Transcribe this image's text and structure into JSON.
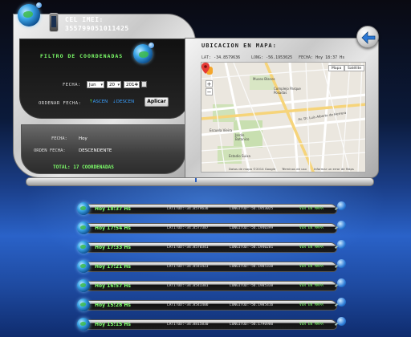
{
  "device": {
    "label": "CEL IMEI:",
    "imei": "355799051011425"
  },
  "filter": {
    "title": "FILTRO DE COORDENADAS",
    "date_label": "FECHA:",
    "month": "Jun",
    "day": "20",
    "year": "2014",
    "order_label": "ORDENAR FECHA:",
    "asc_label": "ASCEN",
    "desc_label": "DESCEN",
    "apply_label": "Aplicar"
  },
  "summary": {
    "fecha_label": "FECHA:",
    "fecha_value": "Hoy",
    "order_label": "ORDEN FECHA:",
    "order_value": "DESCENDENTE",
    "total_label": "TOTAL: 17 COORDENADAS"
  },
  "map_panel": {
    "title": "UBICACION EN MAPA:",
    "lat_label": "LAT:",
    "lat_value": "-34.8579636",
    "lng_label": "LONG:",
    "lng_value": "-56.1953025",
    "fecha_label": "FECHA:",
    "fecha_value": "Hoy 18:37 Hs",
    "map_button": "Mapa",
    "sat_button": "Satélite",
    "labels": {
      "museo": "Museo Blanes",
      "complejo": "Complejo Parque Posadas",
      "escuela": "Escuela Vieira",
      "jardin": "Jardín Botánico",
      "estadio": "Estadio Suixa",
      "avenida": "Av. Dr. Luis Alberto de Herrera"
    },
    "attribution": {
      "data": "Datos de mapa ©2014 Google",
      "terms": "Términos de uso",
      "report": "Informar un error de Maps"
    }
  },
  "colors": {
    "accent_green": "#7dff6a",
    "accent_blue": "#3aa0ff",
    "marker_red": "#e53935"
  },
  "list": {
    "lat_prefix": "LATITUD:",
    "lng_prefix": "LONGITUD:",
    "see_label": "VER EN MAPA",
    "items": [
      {
        "time": "Hoy 18:37 Hs",
        "lat": "-34.8579636",
        "lng": "-56.1953025"
      },
      {
        "time": "Hoy 17:54 Hs",
        "lat": "-34.8577387",
        "lng": "-56.1940399"
      },
      {
        "time": "Hoy 17:33 Hs",
        "lat": "-34.8570341",
        "lng": "-56.1940201"
      },
      {
        "time": "Hoy 17:21 Hs",
        "lat": "-34.8541423",
        "lng": "-56.1985338"
      },
      {
        "time": "Hoy 16:57 Hs",
        "lat": "-34.8541381",
        "lng": "-56.1985338"
      },
      {
        "time": "Hoy 15:28 Hs",
        "lat": "-34.8541406",
        "lng": "-56.1985416"
      },
      {
        "time": "Hoy 15:15 Hs",
        "lat": "-34.8815830",
        "lng": "-56.1790900"
      }
    ]
  }
}
